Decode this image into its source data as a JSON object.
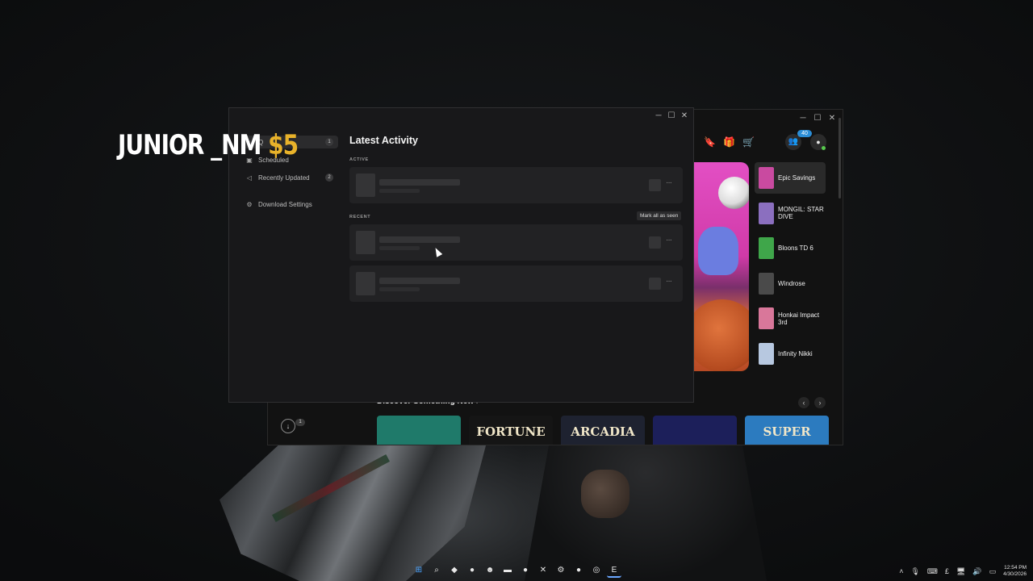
{
  "overlay": {
    "name": "JUNIOR _NM",
    "amount": "$5"
  },
  "downloads_window": {
    "nav": [
      {
        "label": "Q",
        "badge": "1",
        "icon": "download-icon"
      },
      {
        "label": "Scheduled",
        "badge": "",
        "icon": "calendar-icon"
      },
      {
        "label": "Recently Updated",
        "badge": "2",
        "icon": "megaphone-icon"
      },
      {
        "label": "Download Settings",
        "badge": "",
        "icon": "gear-icon"
      }
    ],
    "title": "Latest Activity",
    "active_label": "ACTIVE",
    "recent_label": "RECENT",
    "mark_all_seen": "Mark all as seen",
    "more_glyph": "···"
  },
  "epic_window": {
    "friends_count": "40",
    "sidebar_items": [
      {
        "label": "Epic Savings",
        "active": true,
        "color": "#c94aa0"
      },
      {
        "label": "MONGIL: STAR DIVE",
        "active": false,
        "color": "#8b6fbf"
      },
      {
        "label": "Bloons TD 6",
        "active": false,
        "color": "#3fa64a"
      },
      {
        "label": "Windrose",
        "active": false,
        "color": "#4a4a4a"
      },
      {
        "label": "Honkai Impact 3rd",
        "active": false,
        "color": "#d9779a"
      },
      {
        "label": "Infinity Nikki",
        "active": false,
        "color": "#b7c8e0"
      }
    ],
    "discover_title": "Discover Something New",
    "download_badge": "1",
    "tiles": [
      {
        "label": "",
        "color": "#1f7a6a"
      },
      {
        "label": "FORTUNE",
        "color": "#151515"
      },
      {
        "label": "ARCADIA",
        "color": "#1e2230"
      },
      {
        "label": "",
        "color": "#1c1f5a"
      },
      {
        "label": "SUPER",
        "color": "#2c7bbf"
      }
    ]
  },
  "taskbar": {
    "apps": [
      "windows-icon",
      "search-icon",
      "browser-icon",
      "app-icon",
      "discord-icon",
      "folder-icon",
      "app-icon",
      "xbox-icon",
      "steam-icon",
      "app-icon",
      "chrome-icon",
      "epic-icon"
    ],
    "time": "12:54 PM",
    "date": "4/30/2026"
  }
}
